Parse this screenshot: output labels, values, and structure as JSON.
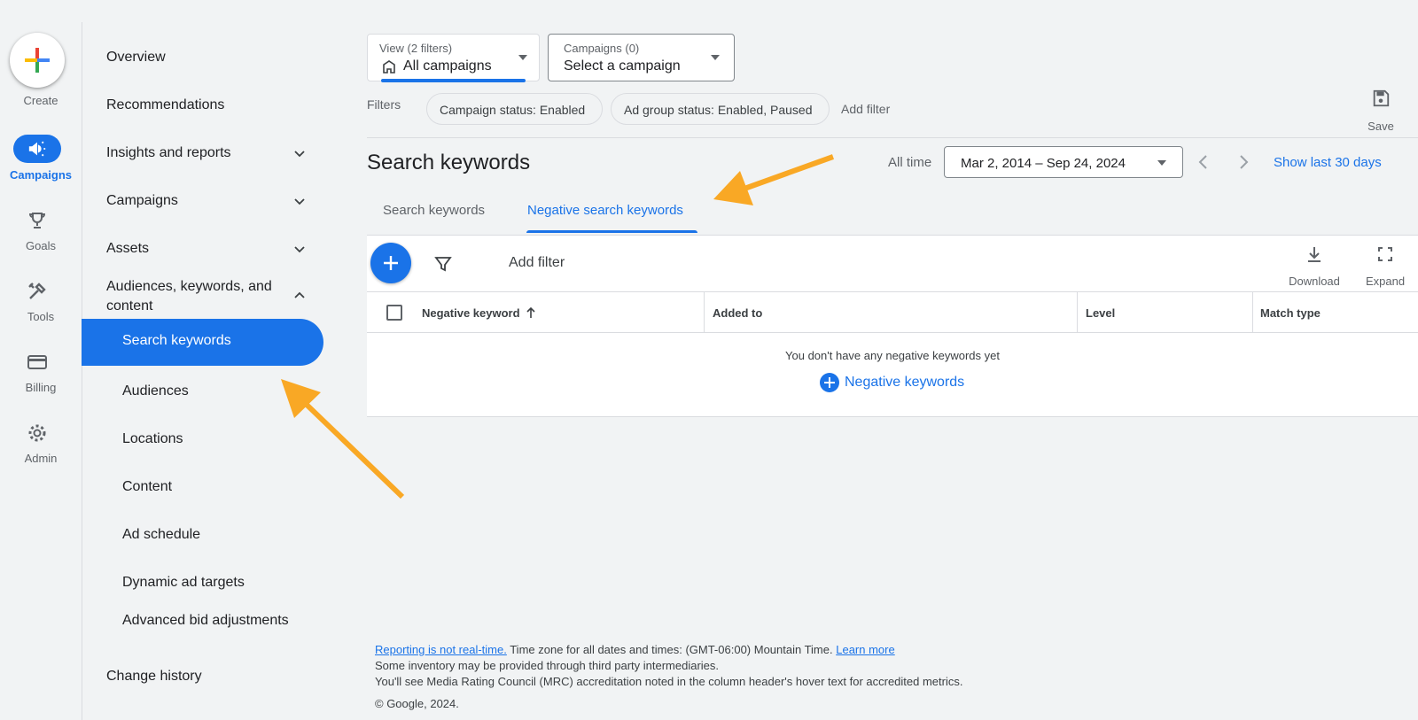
{
  "rail": {
    "create": "Create",
    "campaigns": "Campaigns",
    "goals": "Goals",
    "tools": "Tools",
    "billing": "Billing",
    "admin": "Admin"
  },
  "nav": {
    "overview": "Overview",
    "recommendations": "Recommendations",
    "insights": "Insights and reports",
    "campaigns": "Campaigns",
    "assets": "Assets",
    "audiences_group": "Audiences, keywords, and content",
    "search_keywords": "Search keywords",
    "audiences": "Audiences",
    "locations": "Locations",
    "content": "Content",
    "ad_schedule": "Ad schedule",
    "dynamic_ad_targets": "Dynamic ad targets",
    "advanced_bid": "Advanced bid adjustments",
    "change_history": "Change history"
  },
  "view_dropdown": {
    "label": "View (2 filters)",
    "value": "All campaigns"
  },
  "campaign_dropdown": {
    "label": "Campaigns (0)",
    "value": "Select a campaign"
  },
  "filters": {
    "label": "Filters",
    "chips": [
      "Campaign status: Enabled",
      "Ad group status: Enabled, Paused"
    ],
    "add_filter": "Add filter",
    "save": "Save"
  },
  "header": {
    "title": "Search keywords",
    "all_time": "All time",
    "date_range": "Mar 2, 2014 – Sep 24, 2024",
    "show_last": "Show last 30 days"
  },
  "tabs": [
    "Search keywords",
    "Negative search keywords"
  ],
  "table": {
    "add_filter": "Add filter",
    "download": "Download",
    "expand": "Expand",
    "columns": [
      "Negative keyword",
      "Added to",
      "Level",
      "Match type"
    ],
    "empty": "You don't have any negative keywords yet",
    "add_link": "Negative keywords"
  },
  "footer": {
    "reporting_link": "Reporting is not real-time.",
    "timezone": " Time zone for all dates and times: (GMT-06:00) Mountain Time. ",
    "learn_more": "Learn more",
    "line2": "Some inventory may be provided through third party intermediaries.",
    "line3": "You'll see Media Rating Council (MRC) accreditation noted in the column header's hover text for accredited metrics.",
    "copyright": "© Google, 2024."
  },
  "colors": {
    "accent": "#1a73e8",
    "arrow": "#f9a825"
  }
}
